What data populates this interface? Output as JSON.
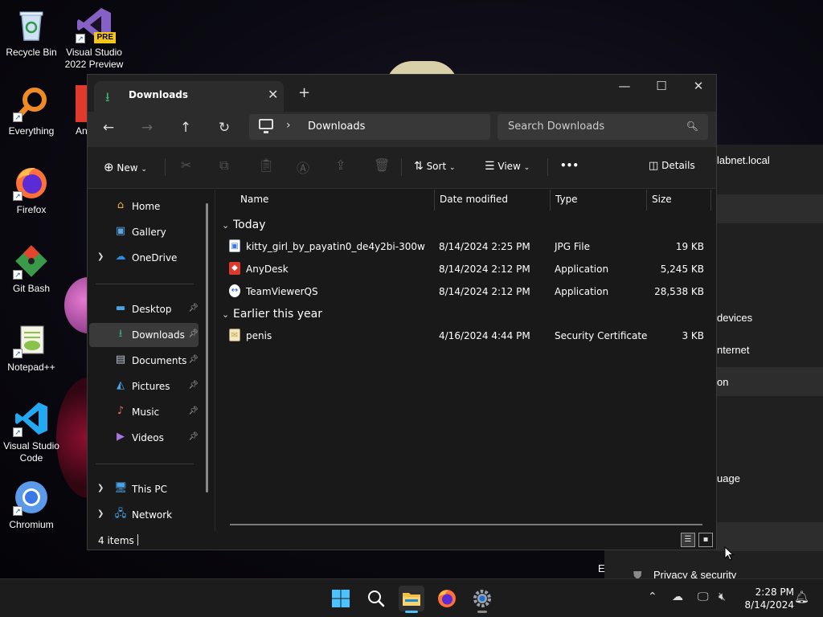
{
  "desktop": {
    "icons": [
      {
        "label": "Recycle Bin"
      },
      {
        "label": "Visual Studio 2022 Preview",
        "badge": "PRE"
      },
      {
        "label": "Everything"
      },
      {
        "label": "Firefox"
      },
      {
        "label": "Git Bash"
      },
      {
        "label": "Notepad++"
      },
      {
        "label": "Visual Studio Code"
      },
      {
        "label": "Chromium"
      },
      {
        "label": "An"
      }
    ]
  },
  "background_settings": {
    "items": [
      "labnet.local",
      "devices",
      "nternet",
      "on",
      "uage",
      "Privacy & security",
      "E"
    ]
  },
  "window": {
    "tab_title": "Downloads",
    "address_path": "Downloads",
    "search_placeholder": "Search Downloads"
  },
  "toolbar": {
    "new_label": "New",
    "sort_label": "Sort",
    "view_label": "View",
    "more_label": "•••",
    "details_label": "Details"
  },
  "sidebar": {
    "items": [
      {
        "label": "Home",
        "icon": "home-icon"
      },
      {
        "label": "Gallery",
        "icon": "gallery-icon"
      },
      {
        "label": "OneDrive",
        "icon": "onedrive-icon"
      },
      {
        "label": "Desktop",
        "icon": "desktop-folder-icon"
      },
      {
        "label": "Downloads",
        "icon": "downloads-folder-icon"
      },
      {
        "label": "Documents",
        "icon": "documents-folder-icon"
      },
      {
        "label": "Pictures",
        "icon": "pictures-folder-icon"
      },
      {
        "label": "Music",
        "icon": "music-folder-icon"
      },
      {
        "label": "Videos",
        "icon": "videos-folder-icon"
      },
      {
        "label": "This PC",
        "icon": "this-pc-icon"
      },
      {
        "label": "Network",
        "icon": "network-icon"
      }
    ]
  },
  "list": {
    "columns": [
      "Name",
      "Date modified",
      "Type",
      "Size"
    ],
    "groups": [
      {
        "label": "Today",
        "files": [
          {
            "name": "kitty_girl_by_payatin0_de4y2bi-300w",
            "date": "8/14/2024 2:25 PM",
            "type": "JPG File",
            "size": "19 KB",
            "icon": "image-file-icon"
          },
          {
            "name": "AnyDesk",
            "date": "8/14/2024 2:12 PM",
            "type": "Application",
            "size": "5,245 KB",
            "icon": "anydesk-icon"
          },
          {
            "name": "TeamViewerQS",
            "date": "8/14/2024 2:12 PM",
            "type": "Application",
            "size": "28,538 KB",
            "icon": "teamviewer-icon"
          }
        ]
      },
      {
        "label": "Earlier this year",
        "files": [
          {
            "name": "penis",
            "date": "4/16/2024 4:44 PM",
            "type": "Security Certificate",
            "size": "3 KB",
            "icon": "certificate-icon"
          }
        ]
      }
    ]
  },
  "status": {
    "count": "4 items"
  },
  "taskbar": {
    "time": "2:28 PM",
    "date": "8/14/2024"
  },
  "colors": {
    "accent": "#4cc2ff",
    "window_bg": "#191919",
    "download_green": "#3db37a"
  }
}
